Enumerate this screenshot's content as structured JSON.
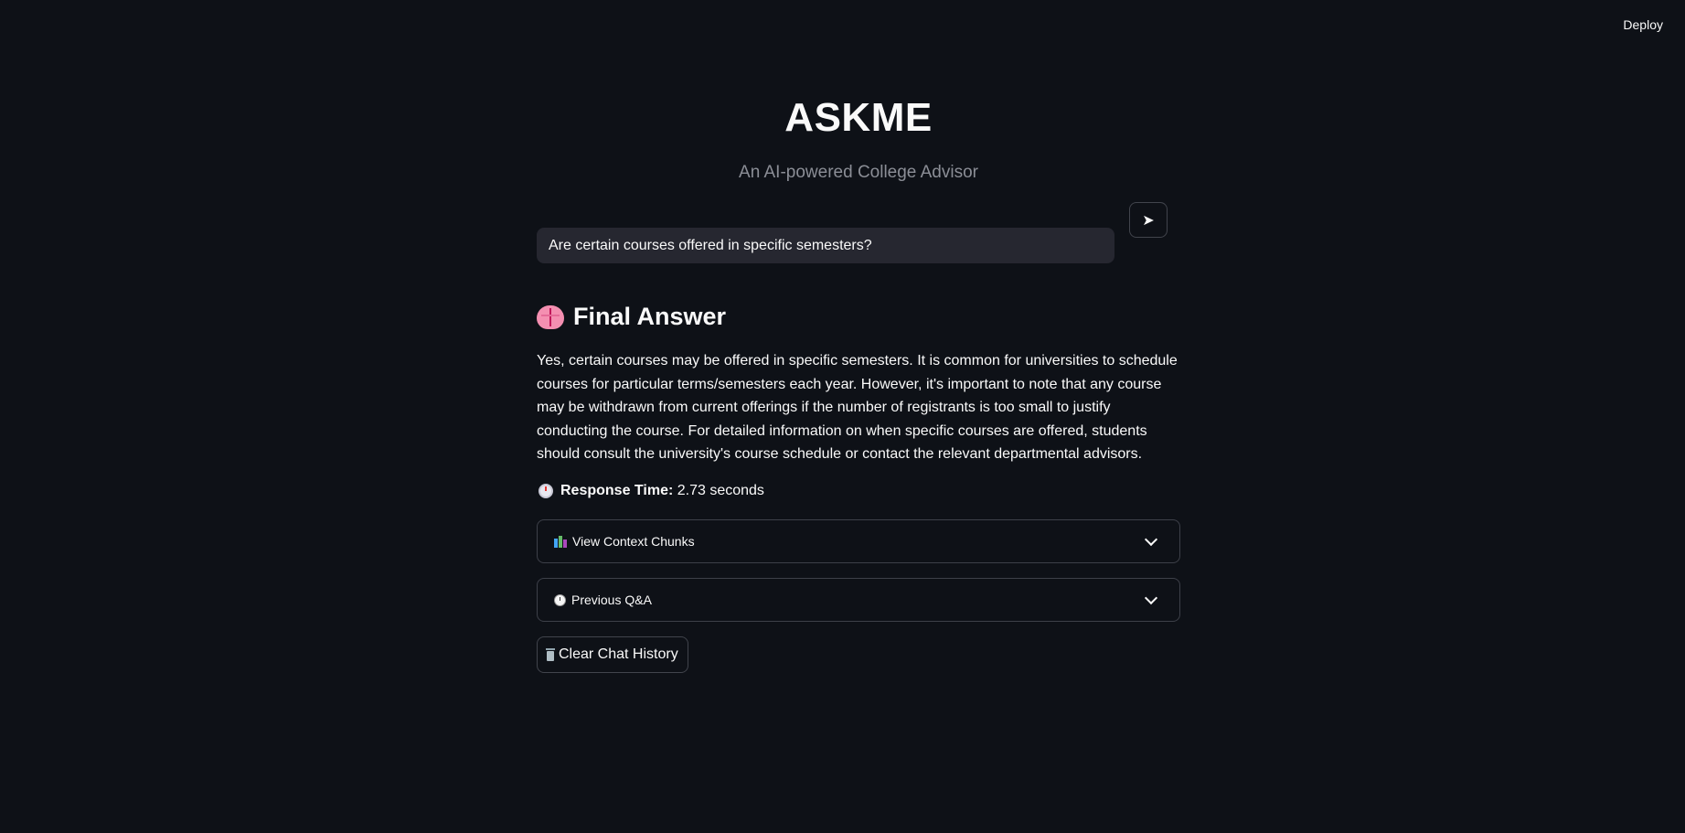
{
  "header": {
    "deploy_label": "Deploy"
  },
  "main": {
    "title": "ASKME",
    "subtitle": "An AI-powered College Advisor",
    "query_value": "Are certain courses offered in specific semesters?",
    "send_icon": "➤",
    "answer_heading": "Final Answer",
    "answer_text": "Yes, certain courses may be offered in specific semesters. It is common for universities to schedule courses for particular terms/semesters each year. However, it's important to note that any course may be withdrawn from current offerings if the number of registrants is too small to justify conducting the course. For detailed information on when specific courses are offered, students should consult the university's course schedule or contact the relevant departmental advisors.",
    "response_time_label": "Response Time:",
    "response_time_value": "2.73 seconds",
    "context_expander_label": "View Context Chunks",
    "history_expander_label": "Previous Q&A",
    "clear_button_label": "Clear Chat History"
  },
  "icons": {
    "heading": "brain-icon",
    "response_time": "stopwatch-icon",
    "context": "books-icon",
    "history": "clock-icon",
    "clear": "trash-icon",
    "send": "send-arrow-icon",
    "expand": "chevron-down-icon"
  },
  "colors": {
    "background": "#0e1117",
    "input_background": "#262730",
    "border": "#3d4049",
    "text": "#fafafa",
    "muted_text": "#8b8e96"
  }
}
